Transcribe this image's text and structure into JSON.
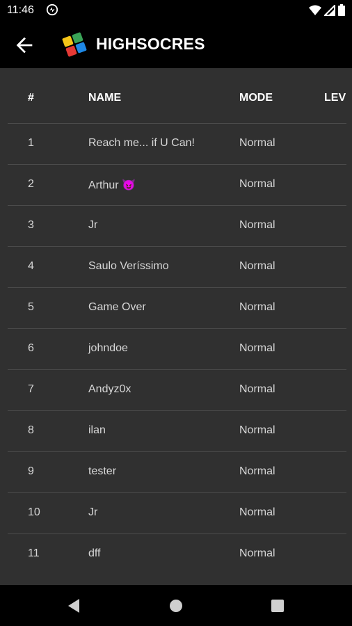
{
  "status_bar": {
    "time": "11:46",
    "icons": [
      "notification-icon",
      "wifi-icon",
      "signal-icon",
      "battery-icon"
    ]
  },
  "app_bar": {
    "title": "HIGHSOCRES",
    "back_icon": "arrow-left-icon"
  },
  "table": {
    "headers": {
      "rank": "#",
      "name": "NAME",
      "mode": "MODE",
      "level": "LEV"
    },
    "rows": [
      {
        "rank": "1",
        "name": "Reach me... if U Can!",
        "mode": "Normal"
      },
      {
        "rank": "2",
        "name": "Arthur 😈",
        "mode": "Normal"
      },
      {
        "rank": "3",
        "name": "Jr",
        "mode": "Normal"
      },
      {
        "rank": "4",
        "name": "Saulo Veríssimo",
        "mode": "Normal"
      },
      {
        "rank": "5",
        "name": "Game Over",
        "mode": "Normal"
      },
      {
        "rank": "6",
        "name": "johndoe",
        "mode": "Normal"
      },
      {
        "rank": "7",
        "name": "Andyz0x",
        "mode": "Normal"
      },
      {
        "rank": "8",
        "name": "ilan",
        "mode": "Normal"
      },
      {
        "rank": "9",
        "name": "tester",
        "mode": "Normal"
      },
      {
        "rank": "10",
        "name": "Jr",
        "mode": "Normal"
      },
      {
        "rank": "11",
        "name": "dff",
        "mode": "Normal"
      }
    ]
  },
  "colors": {
    "background": "#303030",
    "bar": "#000000",
    "divider": "#4b4b4b",
    "text": "#d7d7d7"
  },
  "nav_bar": {
    "icons": [
      "nav-back-icon",
      "nav-home-icon",
      "nav-recents-icon"
    ]
  }
}
